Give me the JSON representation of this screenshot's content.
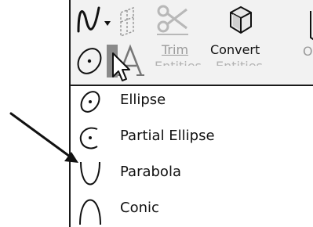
{
  "toolbar": {
    "trim_label": "Trim",
    "trim_sub": "Entities",
    "convert_label": "Convert",
    "convert_sub": "Entities",
    "offset_label": "O"
  },
  "menu": {
    "items": [
      {
        "label": "Ellipse",
        "icon": "ellipse-icon"
      },
      {
        "label": "Partial Ellipse",
        "icon": "partial-ellipse-icon"
      },
      {
        "label": "Parabola",
        "icon": "parabola-icon"
      },
      {
        "label": "Conic",
        "icon": "conic-icon"
      }
    ]
  },
  "colors": {
    "toolbar_bg": "#f2f2f2",
    "highlight": "#8a8a8a",
    "border": "#1a1a1a"
  }
}
